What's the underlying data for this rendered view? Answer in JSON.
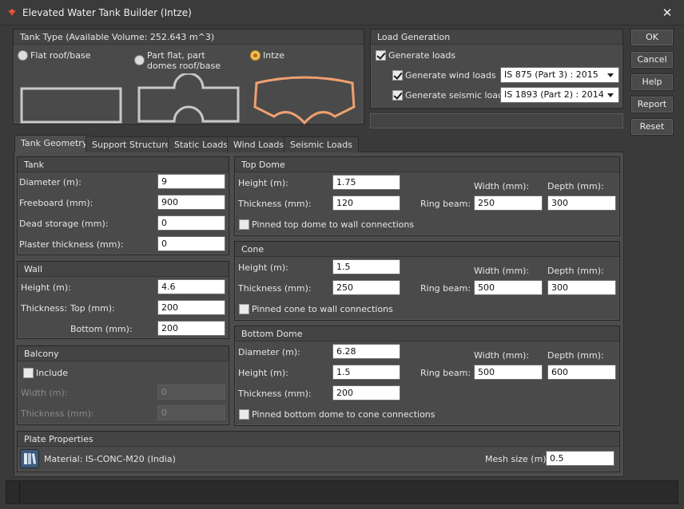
{
  "window": {
    "title": "Elevated Water Tank Builder (Intze)"
  },
  "tank_type": {
    "header": "Tank Type (Available Volume: 252.643 m^3)",
    "options": [
      {
        "label": "Flat roof/base",
        "selected": false
      },
      {
        "label_line1": "Part flat, part",
        "label_line2": "domes roof/base",
        "selected": false
      },
      {
        "label": "Intze",
        "selected": true
      }
    ]
  },
  "load_generation": {
    "header": "Load Generation",
    "generate_loads": {
      "label": "Generate loads",
      "checked": true
    },
    "wind": {
      "label": "Generate wind loads",
      "checked": true,
      "code": "IS 875 (Part 3) : 2015"
    },
    "seismic": {
      "label": "Generate seismic loads",
      "checked": true,
      "code": "IS 1893 (Part 2) : 2014"
    }
  },
  "buttons": {
    "ok": "OK",
    "cancel": "Cancel",
    "help": "Help",
    "report": "Report",
    "reset": "Reset"
  },
  "tabs": [
    "Tank Geometry",
    "Support Structure",
    "Static Loads",
    "Wind Loads",
    "Seismic Loads"
  ],
  "tank": {
    "header": "Tank",
    "diameter": {
      "label": "Diameter (m):",
      "value": "9"
    },
    "freeboard": {
      "label": "Freeboard (mm):",
      "value": "900"
    },
    "dead_storage": {
      "label": "Dead storage (mm):",
      "value": "0"
    },
    "plaster": {
      "label": "Plaster thickness (mm):",
      "value": "0"
    }
  },
  "wall": {
    "header": "Wall",
    "height": {
      "label": "Height (m):",
      "value": "4.6"
    },
    "thickness_label": "Thickness:",
    "top": {
      "label": "Top (mm):",
      "value": "200"
    },
    "bottom": {
      "label": "Bottom (mm):",
      "value": "200"
    }
  },
  "balcony": {
    "header": "Balcony",
    "include": {
      "label": "Include",
      "checked": false
    },
    "width": {
      "label": "Width (m):",
      "value": "0"
    },
    "thickness": {
      "label": "Thickness (mm):",
      "value": "0"
    }
  },
  "top_dome": {
    "header": "Top Dome",
    "height": {
      "label": "Height (m):",
      "value": "1.75"
    },
    "thickness": {
      "label": "Thickness (mm):",
      "value": "120"
    },
    "ring_beam_label": "Ring beam:",
    "width": {
      "label": "Width (mm):",
      "value": "250"
    },
    "depth": {
      "label": "Depth (mm):",
      "value": "300"
    },
    "pinned": {
      "label": "Pinned top dome to wall connections",
      "checked": false
    }
  },
  "cone": {
    "header": "Cone",
    "height": {
      "label": "Height (m):",
      "value": "1.5"
    },
    "thickness": {
      "label": "Thickness (mm):",
      "value": "250"
    },
    "ring_beam_label": "Ring beam:",
    "width": {
      "label": "Width (mm):",
      "value": "500"
    },
    "depth": {
      "label": "Depth (mm):",
      "value": "300"
    },
    "pinned": {
      "label": "Pinned cone to wall connections",
      "checked": false
    }
  },
  "bottom_dome": {
    "header": "Bottom Dome",
    "diameter": {
      "label": "Diameter (m):",
      "value": "6.28"
    },
    "height": {
      "label": "Height (m):",
      "value": "1.5"
    },
    "thickness": {
      "label": "Thickness (mm):",
      "value": "200"
    },
    "ring_beam_label": "Ring beam:",
    "width": {
      "label": "Width (mm):",
      "value": "500"
    },
    "depth": {
      "label": "Depth (mm):",
      "value": "600"
    },
    "pinned": {
      "label": "Pinned bottom dome to cone connections",
      "checked": false
    }
  },
  "plate": {
    "header": "Plate Properties",
    "material": "Material: IS-CONC-M20 (India)",
    "mesh": {
      "label": "Mesh size (m):",
      "value": "0.5"
    }
  },
  "icons": {
    "app": "app-logo-icon",
    "close": "close-icon",
    "material": "material-library-icon"
  },
  "colors": {
    "selected_shape": "#f0a070",
    "shape_outline": "#c8c8c8"
  }
}
